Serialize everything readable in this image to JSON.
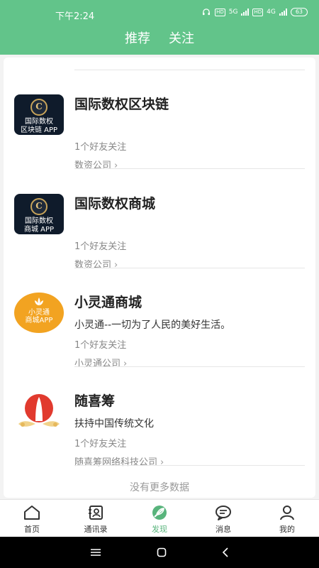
{
  "status_bar": {
    "time": "下午2:24",
    "hd1": "HD",
    "net1": "5G",
    "hd2": "HD",
    "net2": "4G",
    "battery": "63"
  },
  "header_tabs": [
    {
      "label": "推荐"
    },
    {
      "label": "关注"
    }
  ],
  "feed": [
    {
      "title": "国际数权区块链",
      "logo_lines": [
        "国际数权",
        "区块链 APP"
      ],
      "desc": "",
      "friends": "1个好友关注",
      "company": "数资公司"
    },
    {
      "title": "国际数权商城",
      "logo_lines": [
        "国际数权",
        "商城 APP"
      ],
      "desc": "",
      "friends": "1个好友关注",
      "company": "数资公司"
    },
    {
      "title": "小灵通商城",
      "logo_lines": [
        "小灵通",
        "商城APP"
      ],
      "desc": "小灵通--一切为了人民的美好生活。",
      "friends": "1个好友关注",
      "company": "小灵通公司"
    },
    {
      "title": "随喜筹",
      "logo_lines": [],
      "desc": "扶持中国传统文化",
      "friends": "1个好友关注",
      "company": "随喜筹网络科技公司"
    }
  ],
  "no_more_text": "没有更多数据",
  "bottom_nav": [
    {
      "label": "首页",
      "icon": "home-icon"
    },
    {
      "label": "通讯录",
      "icon": "contacts-icon"
    },
    {
      "label": "发现",
      "icon": "discover-icon"
    },
    {
      "label": "消息",
      "icon": "message-icon"
    },
    {
      "label": "我的",
      "icon": "profile-icon"
    }
  ],
  "colors": {
    "header_green": "#62c48a",
    "active_green": "#58b47c"
  }
}
